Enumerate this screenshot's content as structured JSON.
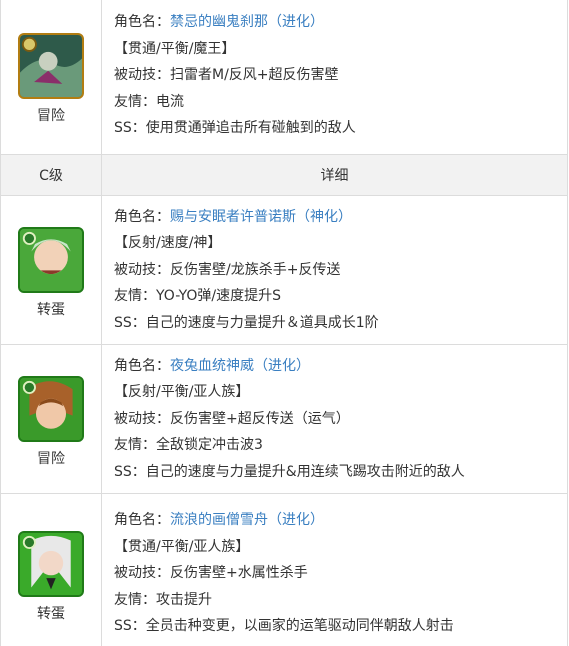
{
  "header": {
    "grade": "C级",
    "detail": "详细"
  },
  "top": {
    "get": "冒险",
    "name_prefix": "角色名：",
    "name": "禁忌的幽鬼刹那（进化）",
    "type": "【贯通/平衡/魔王】",
    "ability": "被动技：扫雷者M/反风+超反伤害壁",
    "friend": "友情：电流",
    "ss": "SS：使用贯通弹追击所有碰触到的敌人"
  },
  "rows": [
    {
      "get": "转蛋",
      "name_prefix": "角色名：",
      "name": "赐与安眠者许普诺斯（神化）",
      "type": "【反射/速度/神】",
      "ability": "被动技：反伤害壁/龙族杀手+反传送",
      "friend": "友情：YO-YO弹/速度提升S",
      "ss": "SS：自己的速度与力量提升＆道具成长1阶"
    },
    {
      "get": "冒险",
      "name_prefix": "角色名：",
      "name": "夜兔血统神威（进化）",
      "type": "【反射/平衡/亚人族】",
      "ability": "被动技：反伤害壁+超反传送（运气）",
      "friend": "友情：全敌锁定冲击波3",
      "ss": "SS：自己的速度与力量提升&用连续飞踢攻击附近的敌人"
    },
    {
      "get": "转蛋",
      "name_prefix": "角色名：",
      "name": "流浪的画僧雪舟（进化）",
      "type": "【贯通/平衡/亚人族】",
      "ability": "被动技：反伤害壁+水属性杀手",
      "friend": "友情：攻击提升",
      "ss": "SS：全员击种变更，以画家的运笔驱动同伴朝敌人射击"
    }
  ]
}
